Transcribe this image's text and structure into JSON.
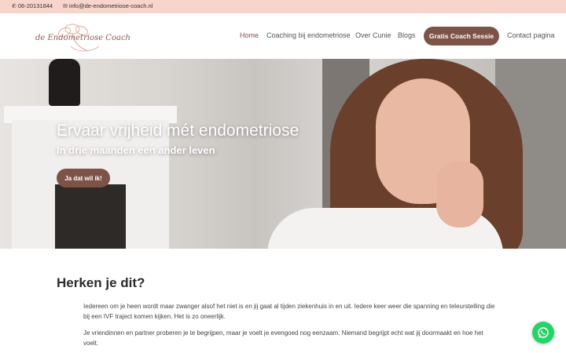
{
  "topbar": {
    "phone": "06-20131844",
    "email": "info@de-endometriose-coach.nl",
    "phone_icon": "phone-icon",
    "email_icon": "envelope-icon"
  },
  "logo": {
    "text": "de Endometriose Coach"
  },
  "nav": {
    "home": "Home",
    "coaching": "Coaching bij endometriose",
    "over": "Over Cunie",
    "blogs": "Blogs",
    "cta": "Gratis Coach Sessie",
    "contact": "Contact pagina"
  },
  "hero": {
    "title": "Ervaar vrijheid mét endometriose",
    "subtitle": "In drie maanden een ander leven",
    "button": "Ja dat wil ik!"
  },
  "content": {
    "heading": "Herken je dit?",
    "paragraphs": [
      "Iedereen om je heen wordt maar zwanger alsof het niet is en jij gaat al tijden ziekenhuis in en uit. Iedere keer weer die spanning en teleurstelling die bij een IVF traject komen kijken. Het is zo oneerlijk.",
      "Je vriendinnen en partner proberen je te begrijpen, maar je voelt je evengoed nog eenzaam. Niemand begrijpt echt wat jij doormaakt en hoe het voelt."
    ]
  },
  "whatsapp": {
    "icon": "whatsapp-icon"
  },
  "colors": {
    "topbar": "#f7d4cc",
    "accent": "#7d5247",
    "nav_active": "#8b5146",
    "whatsapp": "#25d366"
  }
}
